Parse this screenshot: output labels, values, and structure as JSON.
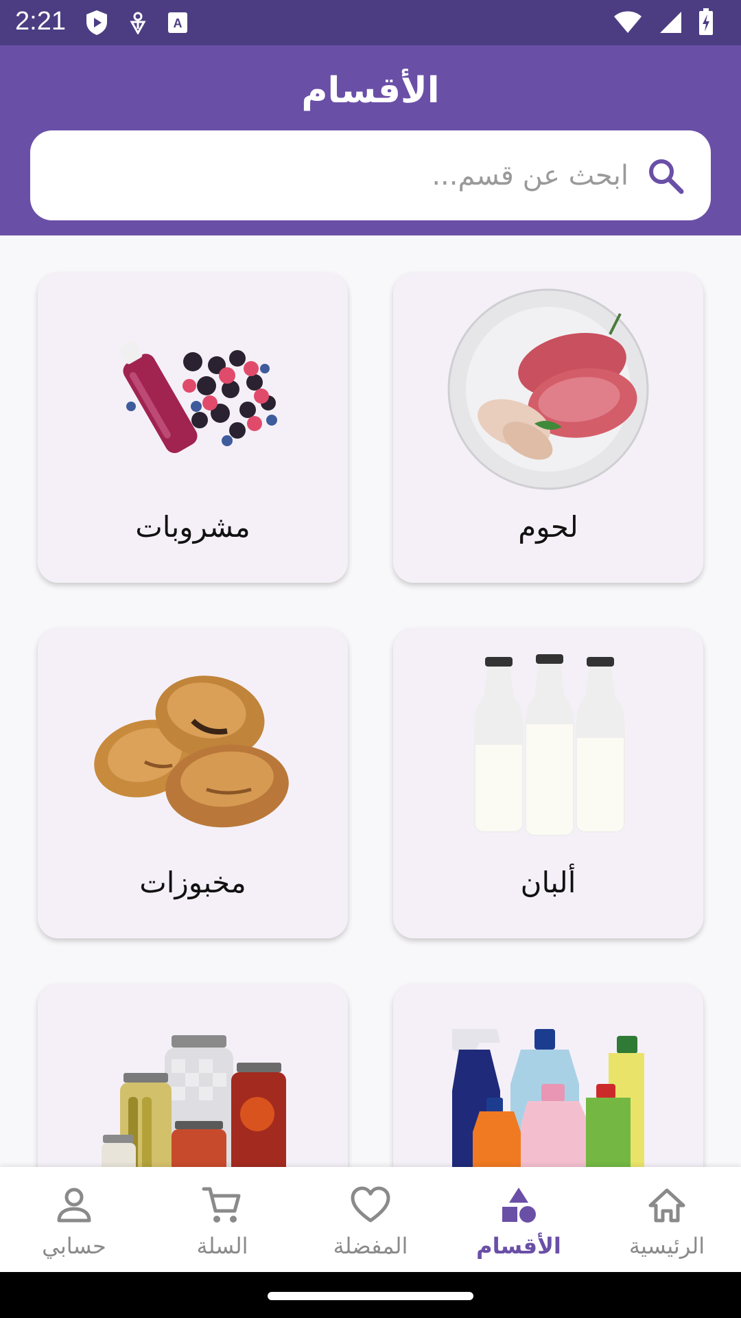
{
  "status_bar": {
    "time": "2:21",
    "icons_left": [
      "play-shield-icon",
      "bug-icon",
      "keyboard-a-icon"
    ],
    "icons_right": [
      "wifi-icon",
      "signal-icon",
      "battery-charging-icon"
    ]
  },
  "header": {
    "title": "الأقسام",
    "background": "#6a4fa7"
  },
  "search": {
    "placeholder": "ابحث عن قسم..."
  },
  "categories": [
    {
      "label": "لحوم",
      "icon": "meat-plate-image"
    },
    {
      "label": "مشروبات",
      "icon": "berry-juice-image"
    },
    {
      "label": "ألبان",
      "icon": "milk-bottles-image"
    },
    {
      "label": "مخبوزات",
      "icon": "pastries-image"
    },
    {
      "label": "",
      "icon": "cleaning-products-image"
    },
    {
      "label": "",
      "icon": "jars-image"
    }
  ],
  "bottom_nav": {
    "items": [
      {
        "label": "الرئيسية",
        "icon": "home-icon",
        "active": false
      },
      {
        "label": "الأقسام",
        "icon": "categories-icon",
        "active": true
      },
      {
        "label": "المفضلة",
        "icon": "heart-icon",
        "active": false
      },
      {
        "label": "السلة",
        "icon": "cart-icon",
        "active": false
      },
      {
        "label": "حسابي",
        "icon": "person-icon",
        "active": false
      }
    ],
    "active_color": "#6a4fa7",
    "inactive_color": "#8a8a8a"
  }
}
